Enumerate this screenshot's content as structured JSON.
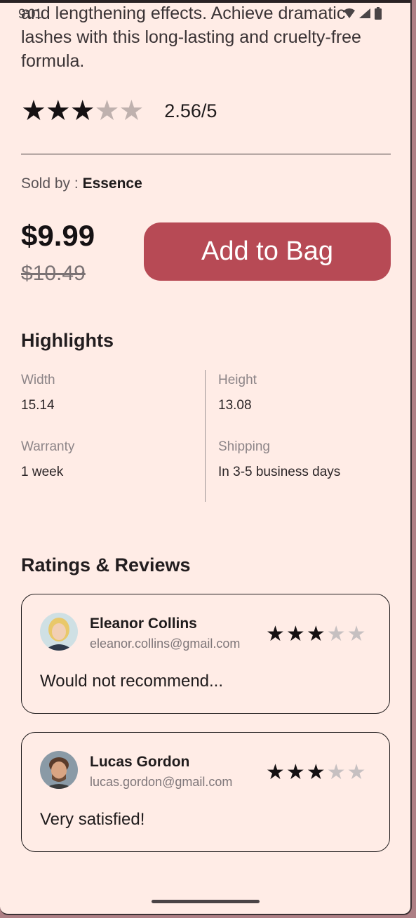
{
  "status_bar": {
    "time": "9:01"
  },
  "description_tail": "and lengthening effects. Achieve dramatic lashes with this long-lasting and cruelty-free formula.",
  "rating": {
    "value": 2.56,
    "text": "2.56/5",
    "stars_filled": 3,
    "stars_total": 5
  },
  "seller": {
    "prefix": "Sold by : ",
    "name": "Essence"
  },
  "price": {
    "current": "$9.99",
    "original": "$10.49"
  },
  "actions": {
    "add_to_bag": "Add to Bag"
  },
  "highlights": {
    "title": "Highlights",
    "items": [
      {
        "label": "Width",
        "value": "15.14"
      },
      {
        "label": "Height",
        "value": "13.08"
      },
      {
        "label": "Warranty",
        "value": "1 week"
      },
      {
        "label": "Shipping",
        "value": "In 3-5 business days"
      }
    ]
  },
  "reviews": {
    "title": "Ratings & Reviews",
    "items": [
      {
        "name": "Eleanor Collins",
        "email": "eleanor.collins@gmail.com",
        "stars_filled": 3,
        "stars_total": 5,
        "text": "Would not recommend..."
      },
      {
        "name": "Lucas Gordon",
        "email": "lucas.gordon@gmail.com",
        "stars_filled": 3,
        "stars_total": 5,
        "text": "Very satisfied!"
      }
    ]
  },
  "colors": {
    "accent": "#b74a55",
    "background": "#ffece6"
  }
}
